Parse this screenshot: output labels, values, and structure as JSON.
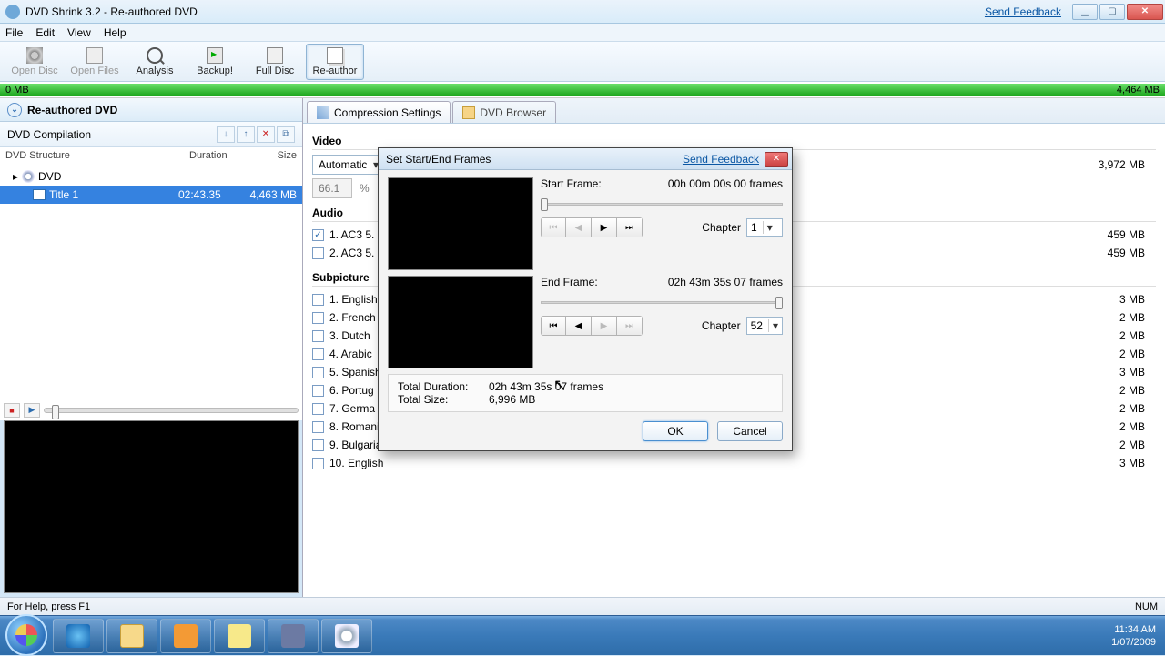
{
  "window": {
    "title": "DVD Shrink 3.2 - Re-authored DVD",
    "send_feedback": "Send Feedback"
  },
  "menu": {
    "file": "File",
    "edit": "Edit",
    "view": "View",
    "help": "Help"
  },
  "toolbar": {
    "open_disc": "Open Disc",
    "open_files": "Open Files",
    "analysis": "Analysis",
    "backup": "Backup!",
    "full_disc": "Full Disc",
    "reauthor": "Re-author"
  },
  "usage": {
    "left": "0 MB",
    "right": "4,464 MB"
  },
  "left": {
    "header": "Re-authored DVD",
    "compilation": "DVD Compilation",
    "cols": {
      "structure": "DVD Structure",
      "duration": "Duration",
      "size": "Size"
    },
    "rows": [
      {
        "name": "DVD",
        "duration": "",
        "size": ""
      },
      {
        "name": "Title 1",
        "duration": "02:43.35",
        "size": "4,463 MB"
      }
    ]
  },
  "tabs": {
    "compression": "Compression Settings",
    "browser": "DVD Browser"
  },
  "settings": {
    "video": {
      "heading": "Video",
      "mode": "Automatic",
      "pct": "66.1",
      "pct_sym": "%",
      "size": "3,972 MB"
    },
    "audio": {
      "heading": "Audio",
      "items": [
        {
          "label": "1. AC3 5.",
          "size": "459 MB",
          "checked": true
        },
        {
          "label": "2. AC3 5.",
          "size": "459 MB",
          "checked": false
        }
      ]
    },
    "sub": {
      "heading": "Subpicture",
      "items": [
        {
          "label": "1. English",
          "size": "3 MB"
        },
        {
          "label": "2. French",
          "size": "2 MB"
        },
        {
          "label": "3. Dutch",
          "size": "2 MB"
        },
        {
          "label": "4. Arabic",
          "size": "2 MB"
        },
        {
          "label": "5. Spanish",
          "size": "3 MB"
        },
        {
          "label": "6. Portug",
          "size": "2 MB"
        },
        {
          "label": "7. Germa",
          "size": "2 MB"
        },
        {
          "label": "8. Romanian",
          "size": "2 MB"
        },
        {
          "label": "9. Bulgarian",
          "size": "2 MB"
        },
        {
          "label": "10. English",
          "size": "3 MB"
        }
      ]
    }
  },
  "dialog": {
    "title": "Set Start/End Frames",
    "feedback": "Send Feedback",
    "start": {
      "label": "Start Frame:",
      "value": "00h 00m 00s 00 frames",
      "chapter_label": "Chapter",
      "chapter": "1"
    },
    "end": {
      "label": "End Frame:",
      "value": "02h 43m 35s 07 frames",
      "chapter_label": "Chapter",
      "chapter": "52"
    },
    "totals": {
      "dur_label": "Total Duration:",
      "dur": "02h 43m 35s 07 frames",
      "size_label": "Total Size:",
      "size": "6,996 MB"
    },
    "ok": "OK",
    "cancel": "Cancel"
  },
  "status": {
    "help": "For Help, press F1",
    "num": "NUM"
  },
  "tray": {
    "time": "11:34 AM",
    "date": "1/07/2009"
  }
}
